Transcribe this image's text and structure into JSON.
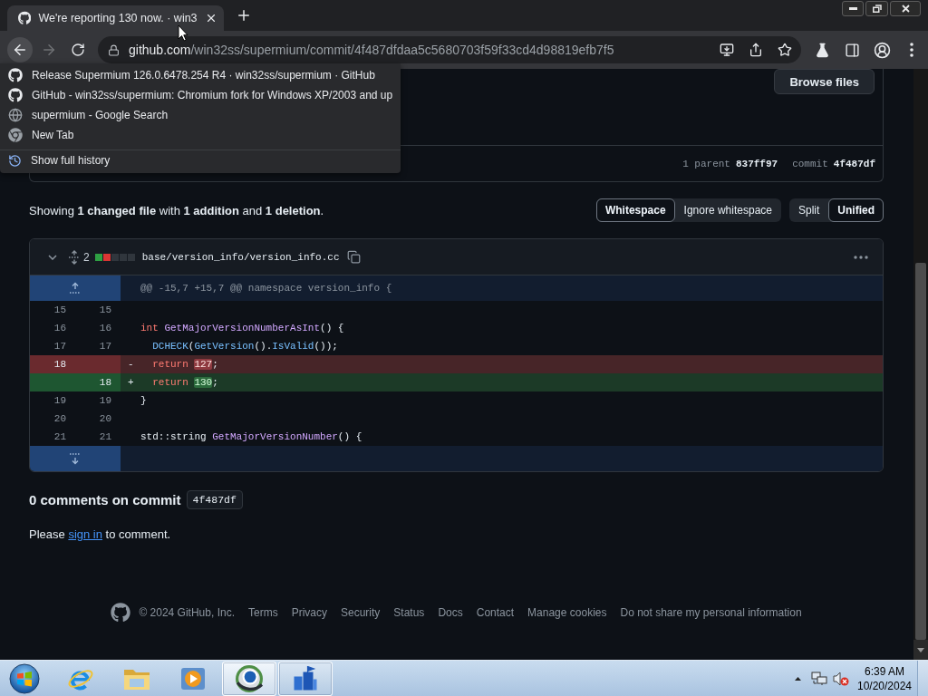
{
  "browser": {
    "tabs": [
      {
        "title": "We're reporting 130 now. · win3",
        "selected": true
      }
    ],
    "forward_disabled": true,
    "address": {
      "host": "github.com",
      "path": "/win32ss/supermium/commit/4f487dfdaa5c5680703f59f33cd4d98819efb7f5"
    },
    "history_menu": {
      "items": [
        {
          "kind": "github",
          "label": "Release Supermium 126.0.6478.254 R4 · win32ss/supermium · GitHub"
        },
        {
          "kind": "github",
          "label": "GitHub - win32ss/supermium: Chromium fork for Windows XP/2003 and up"
        },
        {
          "kind": "search",
          "label": "supermium - Google Search"
        },
        {
          "kind": "newtab",
          "label": "New Tab"
        }
      ],
      "show_all": "Show full history"
    }
  },
  "commit": {
    "browse_button": "Browse files",
    "parent_label": "1 parent",
    "parent_sha": "837ff97",
    "commit_label": "commit",
    "commit_sha": "4f487df"
  },
  "diff_toolbar": {
    "summary": "Showing **1 changed file** with **1 addition** and **1 deletion**.",
    "whitespace": [
      {
        "label": "Whitespace",
        "selected": true
      },
      {
        "label": "Ignore whitespace",
        "selected": false
      }
    ],
    "view": [
      {
        "label": "Split",
        "selected": false
      },
      {
        "label": "Unified",
        "selected": true
      }
    ]
  },
  "file": {
    "expanded": true,
    "changes": "2",
    "diffstat": [
      {
        "color": "#2ea043"
      },
      {
        "color": "#da3633"
      },
      {
        "color": "#30363d"
      },
      {
        "color": "#30363d"
      },
      {
        "color": "#30363d"
      }
    ],
    "path": "base/version_info/version_info.cc",
    "hunk": "@@ -15,7 +15,7 @@ namespace version_info {",
    "lines": [
      {
        "kind": "context",
        "old": "15",
        "new": "15"
      },
      {
        "kind": "context",
        "old": "16",
        "new": "16",
        "tokens": [
          {
            "kind": "keyword",
            "text": "int "
          },
          {
            "kind": "entity",
            "text": "GetMajorVersionNumberAsInt"
          },
          {
            "kind": "plain",
            "text": "() {"
          }
        ]
      },
      {
        "kind": "context",
        "old": "17",
        "new": "17",
        "tokens": [
          {
            "kind": "constant",
            "text": "  DCHECK"
          },
          {
            "kind": "plain",
            "text": "("
          },
          {
            "kind": "constant",
            "text": "GetVersion"
          },
          {
            "kind": "plain",
            "text": "()."
          },
          {
            "kind": "constant",
            "text": "IsValid"
          },
          {
            "kind": "plain",
            "text": "());"
          }
        ]
      },
      {
        "kind": "deletion",
        "old": "18",
        "marker": "-",
        "tokens": [
          {
            "kind": "keyword",
            "text": "  return "
          },
          {
            "kind": "removed",
            "text": "127"
          },
          {
            "kind": "plain",
            "text": ";"
          }
        ]
      },
      {
        "kind": "addition",
        "new": "18",
        "marker": "+",
        "tokens": [
          {
            "kind": "keyword",
            "text": "  return "
          },
          {
            "kind": "inserted",
            "text": "130"
          },
          {
            "kind": "plain",
            "text": ";"
          }
        ]
      },
      {
        "kind": "context",
        "old": "19",
        "new": "19",
        "tokens": [
          {
            "kind": "plain",
            "text": "}"
          }
        ]
      },
      {
        "kind": "context",
        "old": "20",
        "new": "20"
      },
      {
        "kind": "context",
        "old": "21",
        "new": "21",
        "tokens": [
          {
            "kind": "plain",
            "text": "std::string "
          },
          {
            "kind": "entity",
            "text": "GetMajorVersionNumber"
          },
          {
            "kind": "plain",
            "text": "() {"
          }
        ]
      }
    ]
  },
  "comments": {
    "heading": "0 comments on commit",
    "sha": "4f487df",
    "prompt_before": "Please",
    "link": "sign in",
    "prompt_after": "to comment."
  },
  "footer": {
    "copyright": "© 2024 GitHub, Inc.",
    "links": [
      "Terms",
      "Privacy",
      "Security",
      "Status",
      "Docs",
      "Contact",
      "Manage cookies",
      "Do not share my personal information"
    ]
  },
  "taskbar": {
    "apps": [
      {
        "kind": "ie",
        "running": false,
        "selected": false
      },
      {
        "kind": "explorer",
        "running": false,
        "selected": false
      },
      {
        "kind": "media",
        "running": false,
        "selected": false
      },
      {
        "kind": "browser",
        "running": true,
        "selected": true
      },
      {
        "kind": "tool",
        "running": true,
        "selected": false
      }
    ],
    "clock": {
      "time": "6:39 AM",
      "date": "10/20/2024"
    }
  }
}
